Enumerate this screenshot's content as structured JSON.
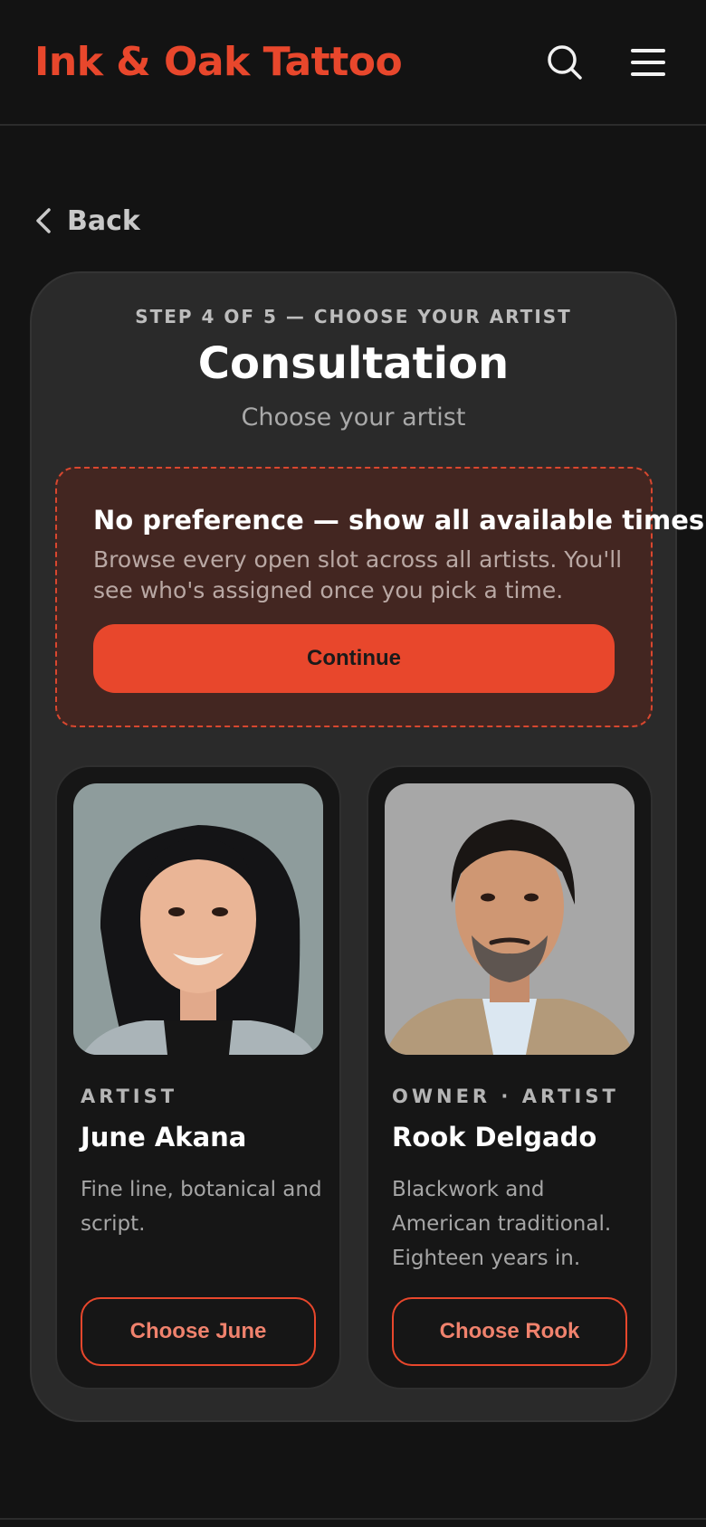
{
  "header": {
    "brand": "Ink & Oak Tattoo",
    "search_icon": "search-icon",
    "menu_icon": "hamburger-menu-icon"
  },
  "nav": {
    "back_label": "Back"
  },
  "booking": {
    "step_label": "STEP 4 OF 5 — CHOOSE YOUR ARTIST",
    "title": "Consultation",
    "subtitle": "Choose your artist",
    "no_preference": {
      "title": "No preference — show all available times",
      "description": "Browse every open slot across all artists. You'll see who's assigned once you pick a time.",
      "button_label": "Continue"
    },
    "artists": [
      {
        "role": "ARTIST",
        "name": "June Akana",
        "bio": "Fine line, botanical and script.",
        "button_label": "Choose June"
      },
      {
        "role": "OWNER · ARTIST",
        "name": "Rook Delgado",
        "bio": "Blackwork and American traditional. Eighteen years in.",
        "button_label": "Choose Rook"
      }
    ]
  },
  "colors": {
    "accent": "#e8472c",
    "background": "#131313",
    "card": "#2a2a2a",
    "artist_card": "#161616",
    "no_preference_bg": "#432621"
  }
}
